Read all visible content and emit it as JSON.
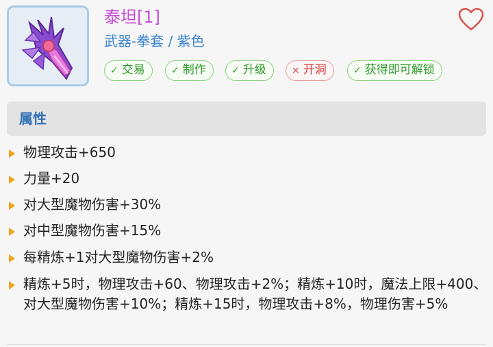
{
  "item": {
    "title": "泰坦[1]",
    "subtitle": "武器-拳套 / 紫色",
    "image_icon": "purple-claw-weapon-icon",
    "favorite_icon": "heart-outline-icon"
  },
  "tags": [
    {
      "label": "交易",
      "status": "yes",
      "mark": "✓"
    },
    {
      "label": "制作",
      "status": "yes",
      "mark": "✓"
    },
    {
      "label": "升级",
      "status": "yes",
      "mark": "✓"
    },
    {
      "label": "开洞",
      "status": "no",
      "mark": "×"
    },
    {
      "label": "获得即可解锁",
      "status": "yes",
      "mark": "✓"
    }
  ],
  "section": {
    "title": "属性"
  },
  "attributes": [
    "物理攻击+650",
    "力量+20",
    "对大型魔物伤害+30%",
    "对中型魔物伤害+15%",
    "每精炼+1对大型魔物伤害+2%",
    "精炼+5时，物理攻击+60、物理攻击+2%；精炼+10时，魔法上限+400、对大型魔物伤害+10%；精炼+15时，物理攻击+8%，物理伤害+5%"
  ],
  "colors": {
    "title": "#c84fd6",
    "subtitle": "#3b86d1",
    "tag_yes": "#2f9a2a",
    "tag_no": "#cf3b3b",
    "section_title": "#2f6fb6",
    "bullet": "#f0a21a",
    "heart": "#d9534f"
  }
}
